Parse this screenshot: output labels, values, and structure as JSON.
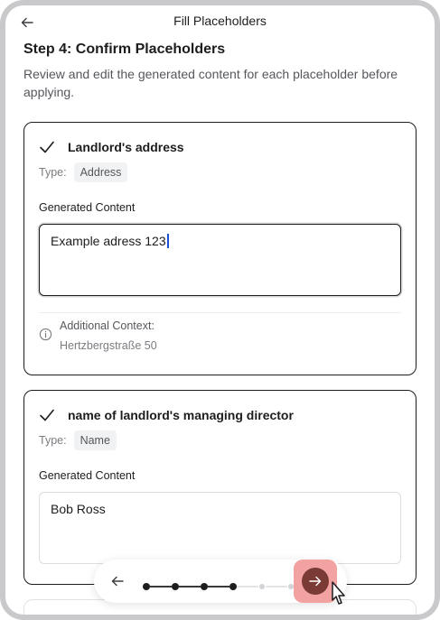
{
  "header": {
    "title": "Fill Placeholders",
    "back_icon": "arrow-left-icon"
  },
  "step": {
    "title": "Step 4: Confirm Placeholders",
    "description": "Review and edit the generated content for each placeholder before applying."
  },
  "placeholders": [
    {
      "title": "Landlord's address",
      "type_label": "Type:",
      "type_value": "Address",
      "generated_label": "Generated Content",
      "generated_value": "Example adress 123",
      "focused": true,
      "context_label": "Additional Context:",
      "context_value": "Hertzbergstraße 50"
    },
    {
      "title": "name of landlord's managing director",
      "type_label": "Type:",
      "type_value": "Name",
      "generated_label": "Generated Content",
      "generated_value": "Bob Ross",
      "focused": false
    }
  ],
  "stepper": {
    "total_steps": 7,
    "current_step": 4,
    "back_icon": "arrow-left-icon",
    "next_icon": "arrow-right-icon",
    "colors": {
      "done": "#1d1d1f",
      "pending": "#d3d4d7",
      "next_button": "#7a3b34",
      "next_highlight": "#f2a3a1"
    }
  }
}
